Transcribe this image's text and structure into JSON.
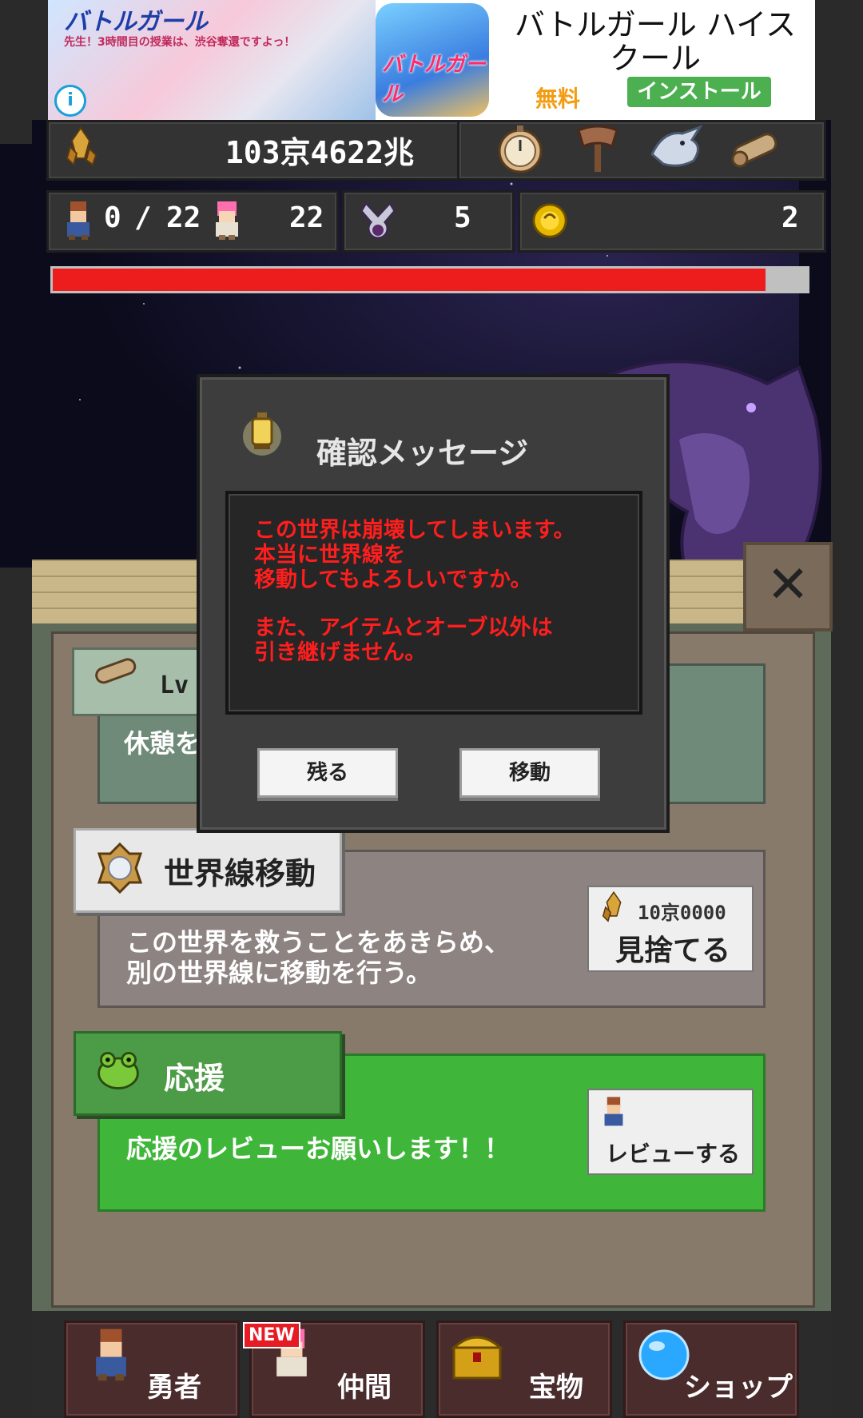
{
  "ad": {
    "banner_logo": "バトルガール",
    "banner_sub": "先生！3時間目の授業は、渋谷奪還ですよっ！",
    "info_icon": "info-icon",
    "app_icon_text": "バトルガール",
    "title": "バトルガール ハイスクール",
    "price": "無料",
    "install_label": "インストール"
  },
  "header": {
    "gold_value": "103京4622兆",
    "gold_icon": "gold-crystal-icon",
    "items": [
      "stopwatch-icon",
      "axe-icon",
      "dragon-head-icon",
      "scroll-icon"
    ],
    "heroes_current": "0",
    "heroes_sep": "/",
    "heroes_max": "22",
    "allies": "22",
    "ring_count": "5",
    "orb_count": "2",
    "hp_fraction": 0.945
  },
  "cards": {
    "rest": {
      "level_label": "Lv",
      "desc": "休憩を"
    },
    "worldline": {
      "title": "世界線移動",
      "desc_line1": "この世界を救うことをあきらめ、",
      "desc_line2": "別の世界線に移動を行う。",
      "cost": "10京0000",
      "button_label": "見捨てる"
    },
    "support": {
      "title": "応援",
      "desc": "応援のレビューお願いします！！",
      "button_label": "レビューする"
    }
  },
  "dialog": {
    "title": "確認メッセージ",
    "message1": "この世界は崩壊してしまいます。\n本当に世界線を\n移動してもよろしいですか。",
    "message2": "また、アイテムとオーブ以外は\n引き継げません。",
    "stay_label": "残る",
    "move_label": "移動"
  },
  "close_icon": "close-icon",
  "nav": {
    "hero_label": "勇者",
    "ally_label": "仲間",
    "treasure_label": "宝物",
    "shop_label": "ショップ",
    "new_badge": "NEW"
  },
  "colors": {
    "dialog_message": "#ff1e1e",
    "hp_bar": "#ee1d1d",
    "support_card": "#3fb63a",
    "install_button": "#4caf50"
  }
}
